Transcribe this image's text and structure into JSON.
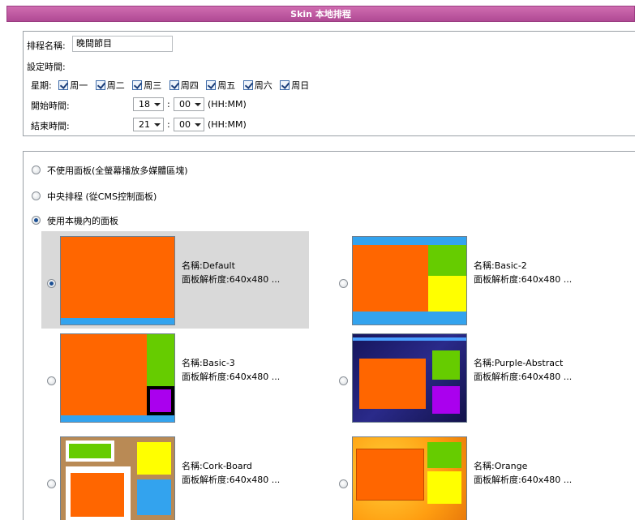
{
  "title": "Skin 本地排程",
  "schedule": {
    "name_label": "排程名稱:",
    "name_value": "晚間節目",
    "time_settings_label": "設定時間:",
    "weekday_label": "星期:",
    "days": [
      "周一",
      "周二",
      "周三",
      "周四",
      "周五",
      "周六",
      "周日"
    ],
    "start_label": "開始時間:",
    "start_hour": "18",
    "start_minute": "00",
    "end_label": "結束時間:",
    "end_hour": "21",
    "end_minute": "00",
    "time_format": "(HH:MM)",
    "separator": ":"
  },
  "layout_options": {
    "no_panel": "不使用面板(全螢幕播放多媒體區塊)",
    "central": "中央排程 (從CMS控制面板)",
    "local": "使用本機內的面板"
  },
  "panels": [
    {
      "name": "名稱:Default",
      "resolution": "面板解析度:640x480 ...",
      "selected": true
    },
    {
      "name": "名稱:Basic-2",
      "resolution": "面板解析度:640x480 ...",
      "selected": false
    },
    {
      "name": "名稱:Basic-3",
      "resolution": "面板解析度:640x480 ...",
      "selected": false
    },
    {
      "name": "名稱:Purple-Abstract",
      "resolution": "面板解析度:640x480 ...",
      "selected": false
    },
    {
      "name": "名稱:Cork-Board",
      "resolution": "面板解析度:640x480 ...",
      "selected": false
    },
    {
      "name": "名稱:Orange",
      "resolution": "面板解析度:640x480 ...",
      "selected": false
    }
  ],
  "colors": {
    "title_bar": "#b04a94",
    "thumb_orange": "#ff6600",
    "thumb_green": "#66cc00",
    "thumb_yellow": "#ffff00",
    "thumb_blue": "#33a3ee",
    "thumb_purple": "#aa00ee",
    "thumb_navy": "#1a1a6e"
  }
}
